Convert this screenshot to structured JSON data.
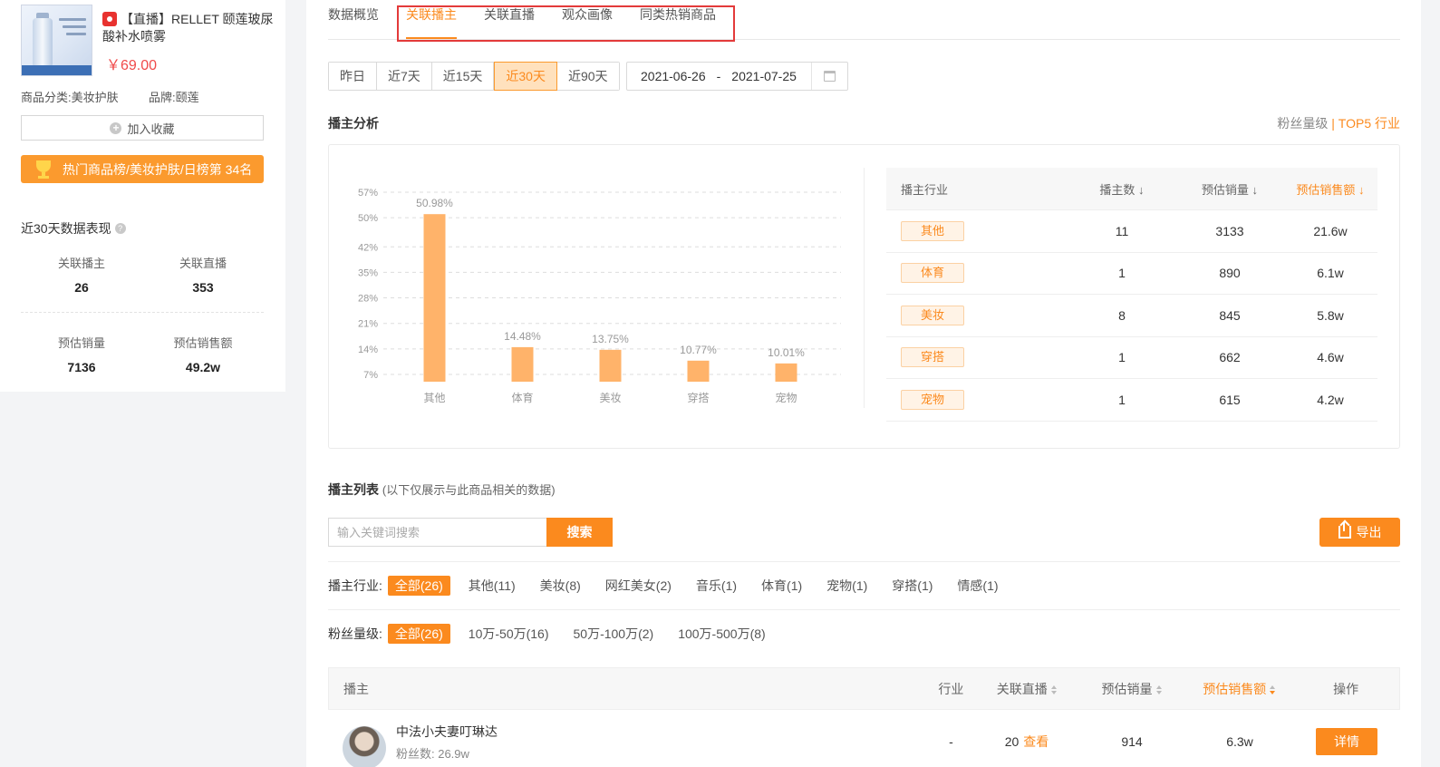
{
  "product": {
    "title": "【直播】RELLET 颐莲玻尿酸补水喷雾",
    "price": "￥69.00",
    "category_label": "商品分类:",
    "category": "美妆护肤",
    "brand_label": "品牌:",
    "brand": "颐莲",
    "favorite_label": "加入收藏",
    "rank_label": "热门商品榜/美妆护肤/日榜第 34名"
  },
  "summary": {
    "title": "近30天数据表现",
    "stats": [
      {
        "label": "关联播主",
        "value": "26"
      },
      {
        "label": "关联直播",
        "value": "353"
      },
      {
        "label": "预估销量",
        "value": "7136"
      },
      {
        "label": "预估销售额",
        "value": "49.2w"
      }
    ]
  },
  "tabs": [
    {
      "label": "数据概览",
      "active": false
    },
    {
      "label": "关联播主",
      "active": true
    },
    {
      "label": "关联直播",
      "active": false
    },
    {
      "label": "观众画像",
      "active": false
    },
    {
      "label": "同类热销商品",
      "active": false
    }
  ],
  "date_buttons": [
    {
      "label": "昨日",
      "active": false
    },
    {
      "label": "近7天",
      "active": false
    },
    {
      "label": "近15天",
      "active": false
    },
    {
      "label": "近30天",
      "active": true
    },
    {
      "label": "近90天",
      "active": false
    }
  ],
  "date_range": {
    "start": "2021-06-26",
    "sep": "-",
    "end": "2021-07-25"
  },
  "analysis": {
    "title": "播主分析",
    "link_fans": "粉丝量级",
    "link_divider": "|",
    "link_top5": "TOP5 行业"
  },
  "chart_data": {
    "type": "bar",
    "categories": [
      "其他",
      "体育",
      "美妆",
      "穿搭",
      "宠物"
    ],
    "values": [
      50.98,
      14.48,
      13.75,
      10.77,
      10.01
    ],
    "value_labels": [
      "50.98%",
      "14.48%",
      "13.75%",
      "10.77%",
      "10.01%"
    ],
    "y_ticks": [
      "7%",
      "14%",
      "21%",
      "28%",
      "35%",
      "42%",
      "50%",
      "57%"
    ],
    "y_tick_values": [
      7,
      14,
      21,
      28,
      35,
      42,
      50,
      57
    ],
    "ylim": [
      5,
      57
    ],
    "grid": true,
    "bar_color": "#ffb36a"
  },
  "industry_table": {
    "headers": [
      "播主行业",
      "播主数",
      "预估销量",
      "预估销售额"
    ],
    "rows": [
      {
        "industry": "其他",
        "count": "11",
        "sales": "3133",
        "amount": "21.6w"
      },
      {
        "industry": "体育",
        "count": "1",
        "sales": "890",
        "amount": "6.1w"
      },
      {
        "industry": "美妆",
        "count": "8",
        "sales": "845",
        "amount": "5.8w"
      },
      {
        "industry": "穿搭",
        "count": "1",
        "sales": "662",
        "amount": "4.6w"
      },
      {
        "industry": "宠物",
        "count": "1",
        "sales": "615",
        "amount": "4.2w"
      }
    ]
  },
  "list": {
    "title": "播主列表",
    "subtitle": "(以下仅展示与此商品相关的数据)",
    "search_placeholder": "输入关键词搜索",
    "search_button": "搜索",
    "export_button": "导出",
    "industry_filter_label": "播主行业:",
    "industry_filters": [
      {
        "label": "全部(26)",
        "active": true
      },
      {
        "label": "其他(11)",
        "active": false
      },
      {
        "label": "美妆(8)",
        "active": false
      },
      {
        "label": "网红美女(2)",
        "active": false
      },
      {
        "label": "音乐(1)",
        "active": false
      },
      {
        "label": "体育(1)",
        "active": false
      },
      {
        "label": "宠物(1)",
        "active": false
      },
      {
        "label": "穿搭(1)",
        "active": false
      },
      {
        "label": "情感(1)",
        "active": false
      }
    ],
    "fans_filter_label": "粉丝量级:",
    "fans_filters": [
      {
        "label": "全部(26)",
        "active": true
      },
      {
        "label": "10万-50万(16)",
        "active": false
      },
      {
        "label": "50万-100万(2)",
        "active": false
      },
      {
        "label": "100万-500万(8)",
        "active": false
      }
    ],
    "headers": {
      "anchor": "播主",
      "industry": "行业",
      "live": "关联直播",
      "sales": "预估销量",
      "amount": "预估销售额",
      "op": "操作"
    },
    "rows": [
      {
        "name": "中法小夫妻叮琳达",
        "fans": "粉丝数: 26.9w",
        "industry": "-",
        "live_count": "20",
        "view": "查看",
        "sales": "914",
        "amount": "6.3w",
        "detail": "详情"
      }
    ]
  },
  "colors": {
    "accent": "#fb8a1e",
    "price": "#f04a4a",
    "highlight_box": "#e33a3a"
  }
}
